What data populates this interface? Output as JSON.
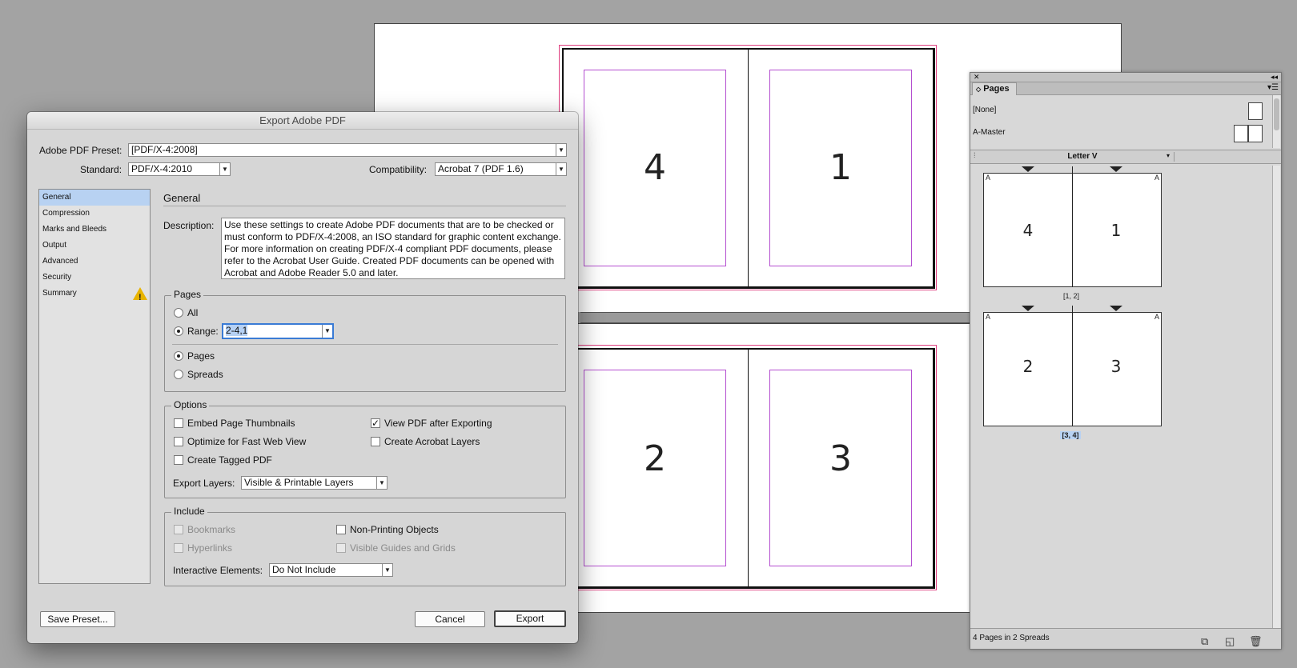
{
  "document": {
    "spreads": [
      {
        "left_page": "4",
        "right_page": "1"
      },
      {
        "left_page": "2",
        "right_page": "3"
      }
    ],
    "colors": {
      "bleed": "#e04080",
      "margin": "#b44fd0"
    }
  },
  "dialog": {
    "title": "Export Adobe PDF",
    "preset_label": "Adobe PDF Preset:",
    "preset_value": "[PDF/X-4:2008]",
    "standard_label": "Standard:",
    "standard_value": "PDF/X-4:2010",
    "compat_label": "Compatibility:",
    "compat_value": "Acrobat 7 (PDF 1.6)",
    "nav": [
      {
        "label": "General"
      },
      {
        "label": "Compression"
      },
      {
        "label": "Marks and Bleeds"
      },
      {
        "label": "Output"
      },
      {
        "label": "Advanced"
      },
      {
        "label": "Security"
      },
      {
        "label": "Summary"
      }
    ],
    "section_title": "General",
    "description_label": "Description:",
    "description_text": "Use these settings to create Adobe PDF documents that are to be checked or must conform to PDF/X-4:2008, an ISO standard for graphic content exchange.  For more information on creating PDF/X-4 compliant PDF documents, please refer to the Acrobat User Guide.  Created PDF documents can be opened with Acrobat and Adobe Reader 5.0 and later.",
    "pages_group": {
      "legend": "Pages",
      "all_label": "All",
      "range_label": "Range:",
      "range_value": "2-4,1",
      "pages_label": "Pages",
      "spreads_label": "Spreads"
    },
    "options_group": {
      "legend": "Options",
      "embed_thumbnails": "Embed Page Thumbnails",
      "view_after": "View PDF after Exporting",
      "optimize": "Optimize for Fast Web View",
      "acrobat_layers": "Create Acrobat Layers",
      "tagged": "Create Tagged PDF",
      "export_layers_label": "Export Layers:",
      "export_layers_value": "Visible & Printable Layers"
    },
    "include_group": {
      "legend": "Include",
      "bookmarks": "Bookmarks",
      "non_printing": "Non-Printing Objects",
      "hyperlinks": "Hyperlinks",
      "guides": "Visible Guides and Grids",
      "interactive_label": "Interactive Elements:",
      "interactive_value": "Do Not Include"
    },
    "buttons": {
      "save_preset": "Save Preset...",
      "cancel": "Cancel",
      "export": "Export"
    },
    "check_mark": "✓"
  },
  "panel": {
    "title": "Pages",
    "masters": [
      {
        "label": "[None]"
      },
      {
        "label": "A-Master"
      }
    ],
    "letter_label": "Letter V",
    "thumb_spreads": [
      {
        "left": "4",
        "right": "1",
        "label": "[1, 2]",
        "master_l": "A",
        "master_r": "A"
      },
      {
        "left": "2",
        "right": "3",
        "label": "[3, 4]",
        "master_l": "A",
        "master_r": "A"
      }
    ],
    "footer_text": "4 Pages in 2 Spreads",
    "close_glyph": "✕",
    "collapse_glyph": "◂◂",
    "menu_glyph": "▾☰",
    "tab_glyph": "◇"
  }
}
